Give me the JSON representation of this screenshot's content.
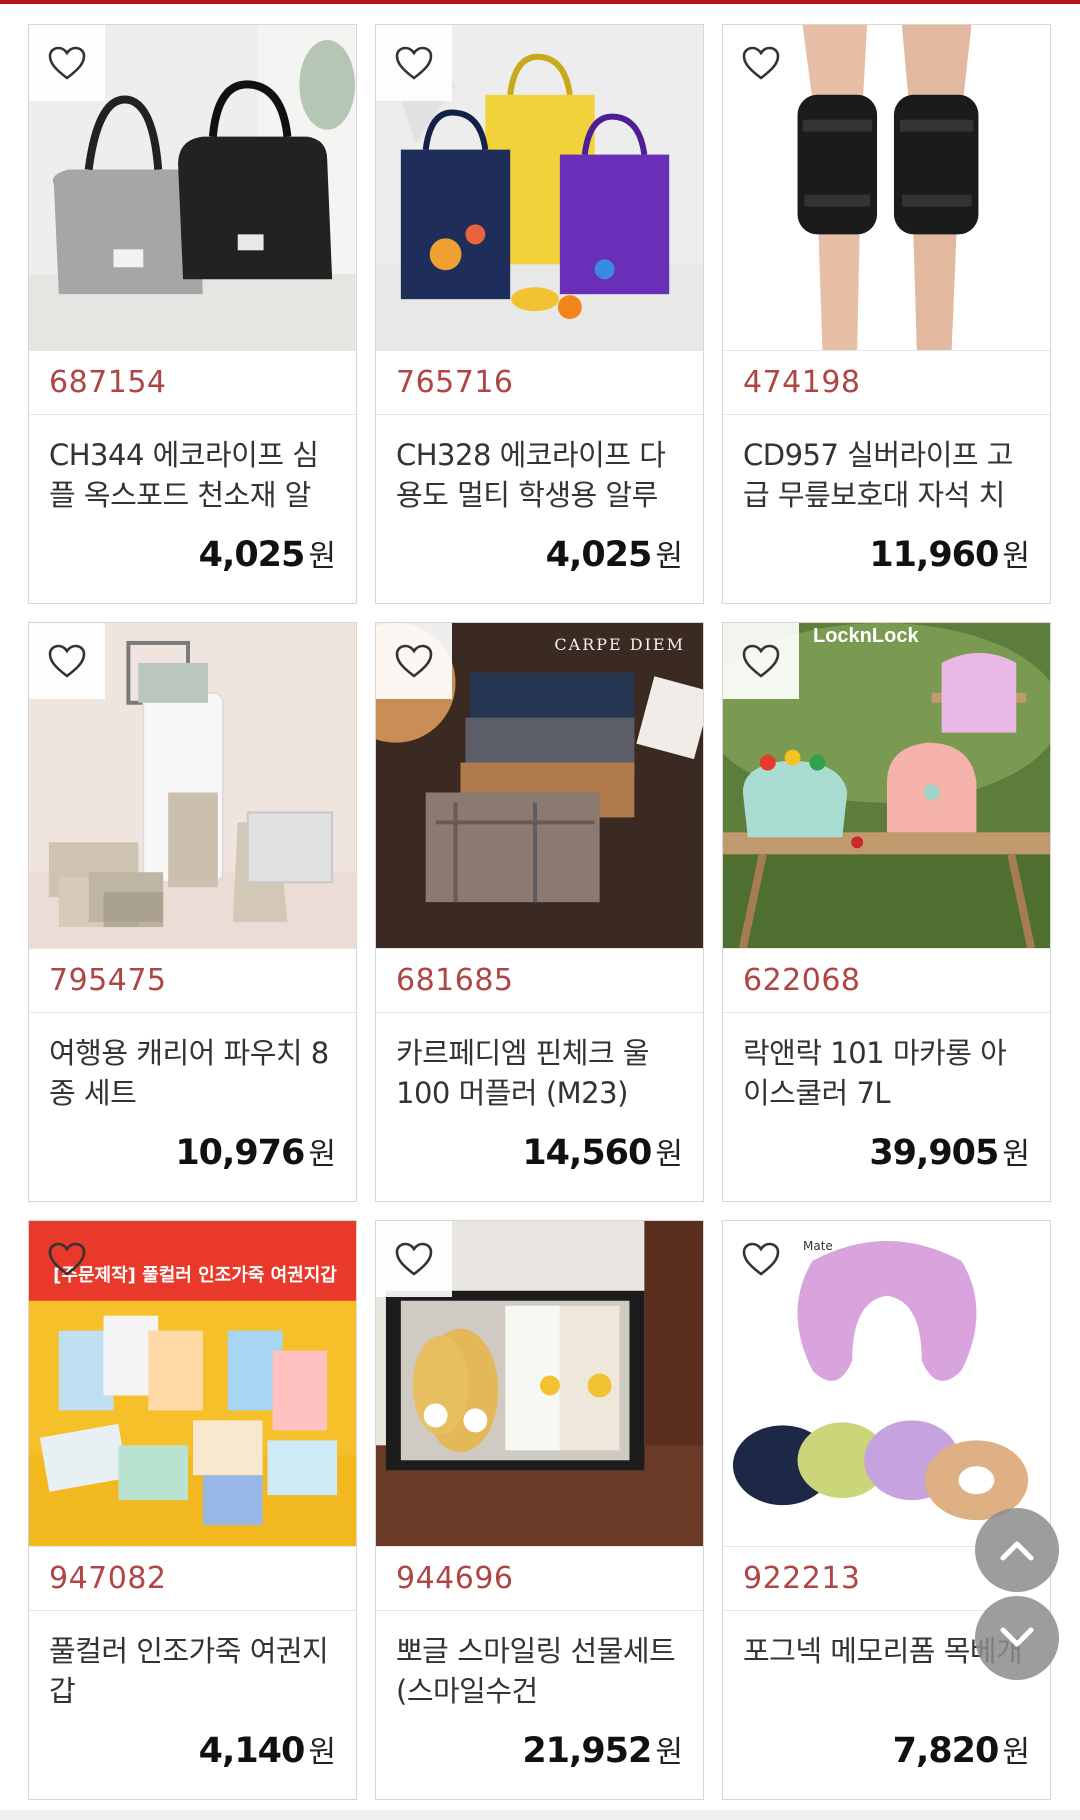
{
  "products": [
    {
      "code": "687154",
      "title": "CH344 에코라이프 심플 옥스포드 천소재 알",
      "price": "4,025",
      "unit": "원",
      "image": "lunch-bag-image"
    },
    {
      "code": "765716",
      "title": "CH328 에코라이프 다용도 멀티 학생용 알루",
      "price": "4,025",
      "unit": "원",
      "image": "kids-tote-bag-image"
    },
    {
      "code": "474198",
      "title": "CD957 실버라이프 고급 무릎보호대 자석 치",
      "price": "11,960",
      "unit": "원",
      "image": "knee-brace-image"
    },
    {
      "code": "795475",
      "title": "여행용 캐리어 파우치 8종 세트",
      "price": "10,976",
      "unit": "원",
      "image": "travel-pouch-image"
    },
    {
      "code": "681685",
      "title": "카르페디엠 핀체크 울100 머플러 (M23)",
      "price": "14,560",
      "unit": "원",
      "image": "muffler-image"
    },
    {
      "code": "622068",
      "title": "락앤락 101 마카롱 아이스쿨러 7L",
      "price": "39,905",
      "unit": "원",
      "image": "ice-cooler-image"
    },
    {
      "code": "947082",
      "title": "풀컬러 인조가죽 여권지갑",
      "price": "4,140",
      "unit": "원",
      "image": "passport-wallet-image"
    },
    {
      "code": "944696",
      "title": "뽀글 스마일링 선물세트(스마일수건",
      "price": "21,952",
      "unit": "원",
      "image": "smile-gift-set-image"
    },
    {
      "code": "922213",
      "title": "포그넥 메모리폼 목베개",
      "price": "7,820",
      "unit": "원",
      "image": "neck-pillow-image"
    }
  ],
  "image_text": {
    "muffler_brand": "CARPE DIEM",
    "cooler_brand": "LocknLock",
    "passport_banner": "[주문제작] 풀컬러 인조가죽 여권지갑",
    "pillow_brand": "Mate"
  },
  "colors": {
    "accent": "#b5141c",
    "product_code": "#b04545",
    "card_border": "#d6d6d6",
    "scroll_button": "#8c8c8c"
  },
  "icons": {
    "wishlist": "heart-outline-icon",
    "scroll_up": "chevron-up-icon",
    "scroll_down": "chevron-down-icon"
  }
}
